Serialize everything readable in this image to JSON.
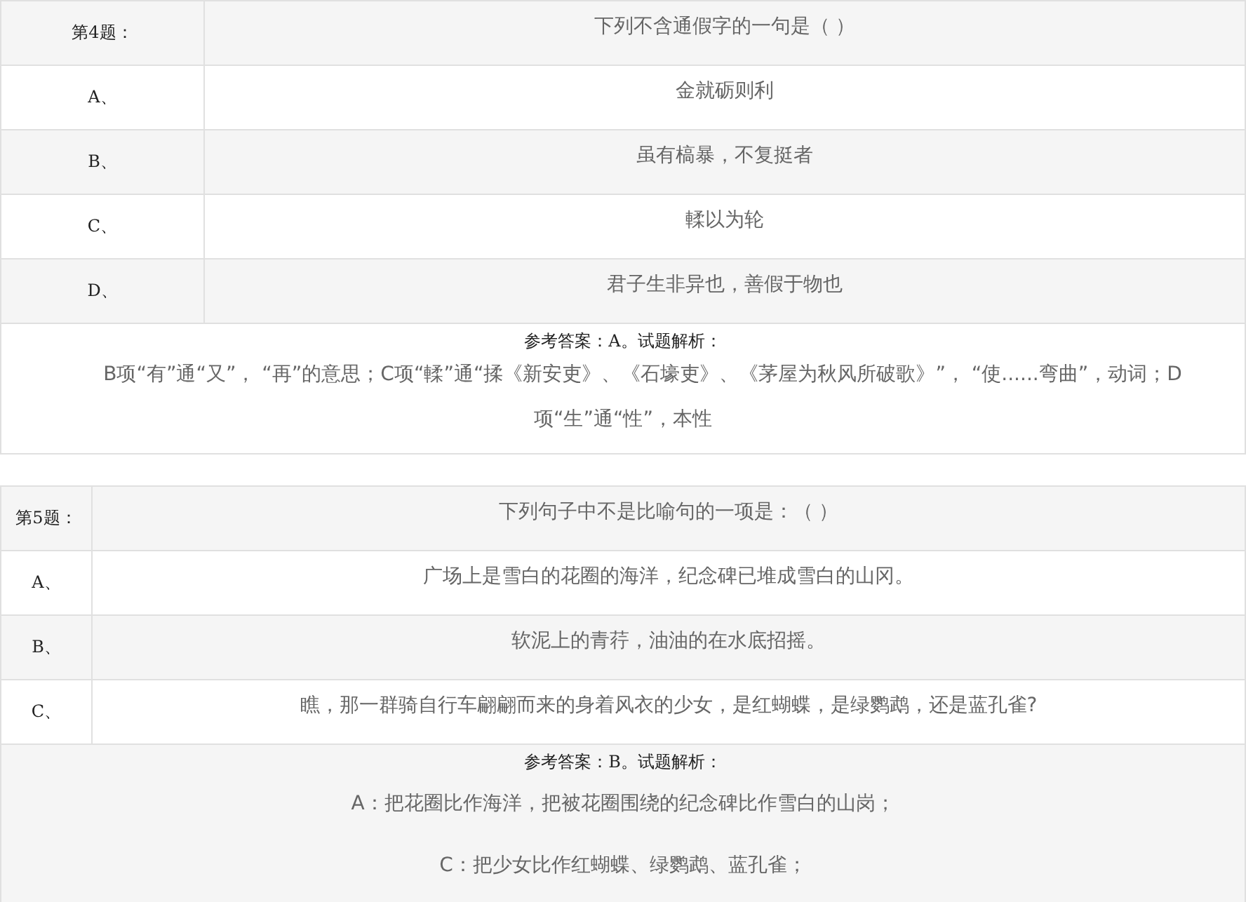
{
  "questions": [
    {
      "number": "第4题：",
      "stem": "下列不含通假字的一句是（    ）",
      "options": [
        {
          "letter": "A、",
          "text": "金就砺则利"
        },
        {
          "letter": "B、",
          "text": "虽有槁暴，不复挺者"
        },
        {
          "letter": "C、",
          "text": "輮以为轮"
        },
        {
          "letter": "D、",
          "text": "君子生非异也，善假于物也"
        }
      ],
      "answer_heading": "参考答案：A。试题解析：",
      "explanation": [
        "B项“有”通“又”， “再”的意思；C项“輮”通“揉《新安吏》、《石壕吏》、《茅屋为秋风所破歌》”， “使......弯曲”，动词；D项“生”通“性”，本性"
      ]
    },
    {
      "number": "第5题：",
      "stem": "下列句子中不是比喻句的一项是：（    ）",
      "options": [
        {
          "letter": "A、",
          "text": "广场上是雪白的花圈的海洋，纪念碑已堆成雪白的山冈。"
        },
        {
          "letter": "B、",
          "text": "软泥上的青荇，油油的在水底招摇。"
        },
        {
          "letter": "C、",
          "text": "瞧，那一群骑自行车翩翩而来的身着风衣的少女，是红蝴蝶，是绿鹦鹉，还是蓝孔雀?"
        }
      ],
      "answer_heading": "参考答案：B。试题解析：",
      "explanation": [
        "A：把花圈比作海洋，把被花圈围绕的纪念碑比作雪白的山岗；",
        "C：把少女比作红蝴蝶、绿鹦鹉、蓝孔雀；"
      ]
    }
  ]
}
